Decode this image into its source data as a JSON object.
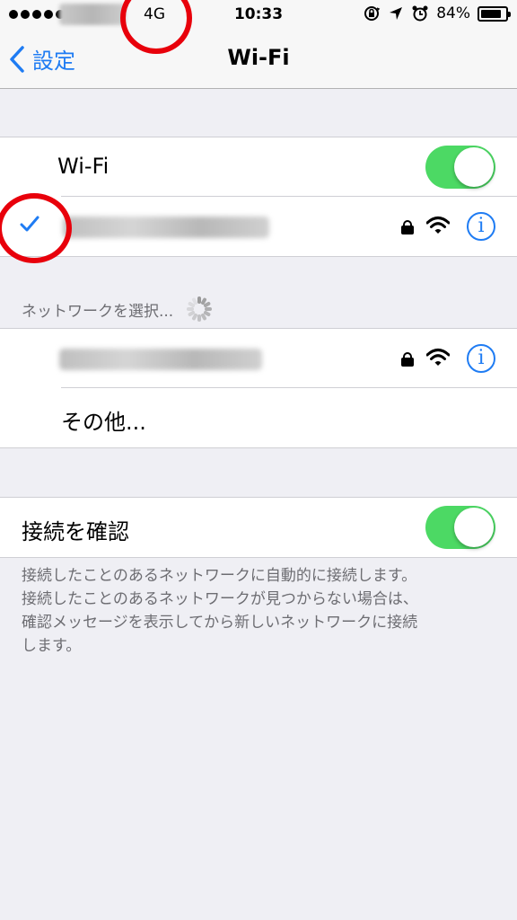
{
  "status_bar": {
    "network_type": "4G",
    "time": "10:33",
    "battery_percent": "84%",
    "battery_level": 0.84,
    "icons": [
      "signal-dots-icon",
      "orientation-lock-icon",
      "location-arrow-icon",
      "alarm-icon",
      "battery-icon"
    ]
  },
  "nav": {
    "back_label": "設定",
    "title": "Wi-Fi"
  },
  "wifi_section": {
    "toggle_label": "Wi-Fi",
    "toggle_on": true,
    "connected_network": {
      "name": "",
      "name_obscured": true,
      "secured": true,
      "selected": true
    }
  },
  "choose_section": {
    "header": "ネットワークを選択...",
    "networks": [
      {
        "name": "",
        "name_obscured": true,
        "secured": true
      }
    ],
    "other_label": "その他..."
  },
  "ask_section": {
    "label": "接続を確認",
    "toggle_on": true,
    "footer_lines": [
      "接続したことのあるネットワークに自動的に接続します。",
      "接続したことのあるネットワークが見つからない場合は、",
      "確認メッセージを表示してから新しいネットワークに接続",
      "します。"
    ]
  },
  "colors": {
    "accent_blue": "#1f7cf3",
    "toggle_green": "#4cd964",
    "annotation_red": "#e8000b",
    "background": "#efeff4"
  }
}
